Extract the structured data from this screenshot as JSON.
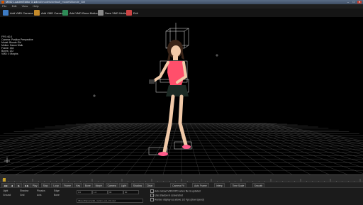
{
  "window": {
    "title": "MMD Loader/Editor 3.1.1",
    "subtitle": "\\mmd\\models\\default_model\\Blonde_Girl",
    "minimize": "–",
    "maximize": "□",
    "close": "✕"
  },
  "menu": {
    "items": [
      "File",
      "Edit",
      "View",
      "Help"
    ]
  },
  "toolbar": {
    "buttons": [
      {
        "label": "Add VMD Camera",
        "icon": "camera-icon",
        "color": "#3d7bc4"
      },
      {
        "label": "Add VMD Camera",
        "icon": "camera-icon",
        "color": "#c48a2a"
      },
      {
        "label": "Add VMD Bone Motion",
        "icon": "bone-icon",
        "color": "#2e8b57"
      },
      {
        "label": "Save VMD Motion",
        "icon": "save-icon",
        "color": "#8a8a8a"
      },
      {
        "label": "Exit",
        "icon": "exit-icon",
        "color": "#cc4444"
      }
    ]
  },
  "overlay": {
    "lines": [
      "FPS: 60.0",
      "Camera: Position Perspective",
      "Model: Blonde Girl",
      "Motion: Dance Walk",
      "Frame: 164",
      "Bones: 122",
      "VMD: 0 Morphs"
    ]
  },
  "timeline": {
    "frame_marks": 60
  },
  "controls": {
    "buttons": [
      "◀◀",
      "◀",
      "▶",
      "▶▶",
      "Play",
      "Stop",
      "Loop",
      "Frame",
      "Key",
      "Bone",
      "Morph",
      "Camera",
      "Light",
      "Shadow",
      "Clear"
    ],
    "labels": [
      {
        "text": "Camera Fit"
      },
      {
        "text": "Auto Frame"
      },
      {
        "text": "Interp"
      },
      {
        "text": "Time Scale"
      },
      {
        "text": "Smooth"
      }
    ]
  },
  "bottom": {
    "left_items": [
      "Light",
      "Shadow",
      "Physics",
      "Edge",
      "Ground",
      "Grid",
      "Axis",
      "Bone"
    ],
    "checkboxes": [
      "Auto reload VMD/VPD when file is updated",
      "Use shadow in screenshot",
      "Render display as above 1/2 Fps (slow speed)"
    ],
    "fields": [
      "0.0",
      "1.0",
      "30",
      "60"
    ],
    "path": "\\Bone\\Dance\\walk_motion_test_01.vmd"
  }
}
